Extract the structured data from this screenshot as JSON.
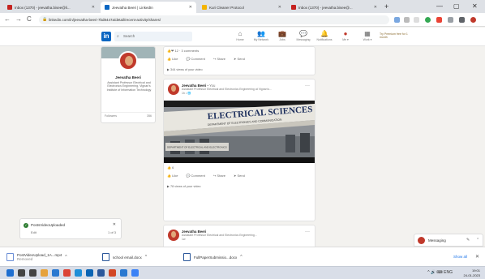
{
  "browser": {
    "tabs": [
      {
        "label": "Inbox (1370) - jeevatha.bisee@li...",
        "favicon_color": "#c5221f"
      },
      {
        "label": "Jeevatha Beeri | LinkedIn",
        "favicon_color": "#0a66c2"
      },
      {
        "label": "Kuri Cleaner Protocol",
        "favicon_color": "#f4b400"
      },
      {
        "label": "Inbox (1370) - jeevatha.bisee@...",
        "favicon_color": "#c5221f"
      }
    ],
    "new_tab": "+",
    "window_controls": {
      "minimize": "—",
      "maximize": "▢",
      "close": "✕"
    },
    "nav": {
      "back": "←",
      "forward": "→",
      "reload": "C"
    },
    "url": "linkedin.com/in/jeevatha-beeri-7bd8447a/detail/recent-activity/shares/",
    "lock": "🔒"
  },
  "linkedin": {
    "logo": "in",
    "search_placeholder": "Search",
    "nav_items": [
      {
        "icon": "⌂",
        "label": "Home"
      },
      {
        "icon": "👥",
        "label": "My Network"
      },
      {
        "icon": "💼",
        "label": "Jobs"
      },
      {
        "icon": "💬",
        "label": "Messaging"
      },
      {
        "icon": "🔔",
        "label": "Notifications"
      },
      {
        "icon": "●",
        "label": "Me ▾"
      },
      {
        "icon": "▦",
        "label": "Work ▾"
      }
    ],
    "premium": "Try Premium free for 1 month"
  },
  "profile": {
    "name": "Jeevatha Beeri",
    "headline": "Assistant Professor Electrical and Electronics Engineering, Vignan's Institute of Information Technology",
    "stat_label": "Followers",
    "stat_value": "356"
  },
  "feed": {
    "card1": {
      "reactions": "👍❤ 12 · 3 comments",
      "actions": [
        "👍 Like",
        "💬 Comment",
        "↪ Share",
        "➤ Send"
      ],
      "views": "▶ 344 views of your video"
    },
    "card2": {
      "author": "Jeevatha Beeri",
      "degree": "• You",
      "headline": "Assistant Professor Electrical and Electronics Engineering at Vignan's...",
      "time": "1h • 🌐",
      "more": "···",
      "image_sign": "ELECTRICAL SCIENCES BLOCK",
      "image_sign_sub": "DEPARTMENT OF ELECTRONICS AND COMMUNICATION",
      "image_plaque": "DEPARTMENT OF ELECTRICAL AND ELECTRONICS",
      "reactions": "👍 6",
      "actions": [
        "👍 Like",
        "💬 Comment",
        "↪ Share",
        "➤ Send"
      ],
      "views": "▶ 78 views of your video"
    },
    "card3": {
      "author": "Jeevatha Beeri",
      "headline": "Assistant Professor Electrical and Electronics Engineering...",
      "time": "1w",
      "more": "···"
    }
  },
  "notification": {
    "title": "PostsVideoUploaded",
    "subtitle": "Edit",
    "close": "✕",
    "right_text": "1 of 3"
  },
  "messaging": {
    "label": "Messaging",
    "icons": [
      "✎",
      "⌃"
    ]
  },
  "downloads": {
    "items": [
      {
        "name": "PostVideoUpload_1A...mp4",
        "status": "Removed"
      },
      {
        "name": "school email.docx",
        "status": ""
      },
      {
        "name": "FullPaperSubmissio...docx",
        "status": ""
      }
    ],
    "caret": "^",
    "show_all": "Show all",
    "close": "✕"
  },
  "taskbar": {
    "icons": [
      {
        "name": "windows-icon",
        "color": "#1f6fd0"
      },
      {
        "name": "search-icon",
        "color": "#444444"
      },
      {
        "name": "task-view-icon",
        "color": "#444444"
      },
      {
        "name": "file-explorer-icon",
        "color": "#e6a23c"
      },
      {
        "name": "store-icon",
        "color": "#2a78d0"
      },
      {
        "name": "chrome-icon",
        "color": "#db4437"
      },
      {
        "name": "edge-icon",
        "color": "#1f8fd8"
      },
      {
        "name": "mail-icon",
        "color": "#0a64b4"
      },
      {
        "name": "word-icon",
        "color": "#2b579a"
      },
      {
        "name": "powerpoint-icon",
        "color": "#d24726"
      },
      {
        "name": "photos-icon",
        "color": "#2a78d0"
      },
      {
        "name": "app-icon",
        "color": "#3b82f6"
      }
    ],
    "tray": "^ 🔊 ⌨ ENG",
    "time": "19:01",
    "date": "24-01-2023"
  }
}
